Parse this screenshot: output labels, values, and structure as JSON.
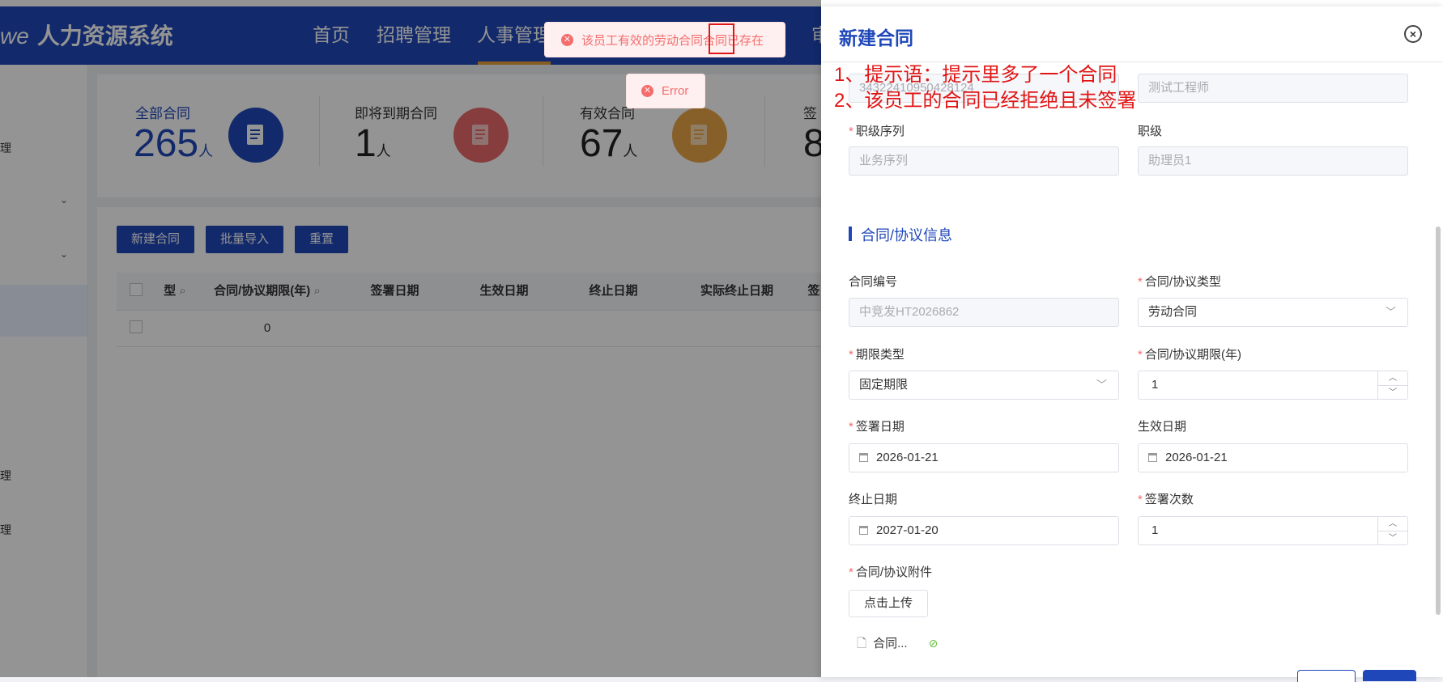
{
  "header": {
    "logo_prefix": "we",
    "logo_title": "人力资源系统",
    "nav": [
      "首页",
      "招聘管理",
      "人事管理",
      "审"
    ]
  },
  "sidebar": {
    "items": [
      "理",
      "理",
      "理"
    ]
  },
  "stats": {
    "unit": "人",
    "cards": [
      {
        "label": "全部合同",
        "value": "265"
      },
      {
        "label": "即将到期合同",
        "value": "1"
      },
      {
        "label": "有效合同",
        "value": "67"
      },
      {
        "label": "签",
        "value": "8"
      }
    ]
  },
  "toolbar": {
    "new_contract": "新建合同",
    "batch_import": "批量导入",
    "reset": "重置"
  },
  "table": {
    "columns": [
      "型",
      "合同/协议期限(年)",
      "签署日期",
      "生效日期",
      "终止日期",
      "实际终止日期",
      "签"
    ],
    "rows": [
      [
        "",
        "0",
        "",
        "",
        "",
        "",
        ""
      ]
    ]
  },
  "toasts": {
    "error_message": "该员工有效的劳动合同合同已存在",
    "error_short": "Error"
  },
  "annotation": {
    "line1": "1、提示语：提示里多了一个合同",
    "line2": "2、该员工的合同已经拒绝且未签署"
  },
  "drawer": {
    "title": "新建合同",
    "close_symbol": "×",
    "top_fields": {
      "id_value": "34322410950428124",
      "position_value": "测试工程师"
    },
    "grade_sequence_label": "职级序列",
    "grade_sequence_value": "业务序列",
    "grade_label": "职级",
    "grade_value": "助理员1",
    "section_title": "合同/协议信息",
    "contract_no_label": "合同编号",
    "contract_no_value": "中竞发HT2026862",
    "contract_type_label": "合同/协议类型",
    "contract_type_value": "劳动合同",
    "term_type_label": "期限类型",
    "term_type_value": "固定期限",
    "term_years_label": "合同/协议期限(年)",
    "term_years_value": "1",
    "sign_date_label": "签署日期",
    "sign_date_value": "2026-01-21",
    "effective_date_label": "生效日期",
    "effective_date_value": "2026-01-21",
    "end_date_label": "终止日期",
    "end_date_value": "2027-01-20",
    "sign_count_label": "签署次数",
    "sign_count_value": "1",
    "attachment_label": "合同/协议附件",
    "upload_button": "点击上传",
    "attachment_file": "合同..."
  }
}
